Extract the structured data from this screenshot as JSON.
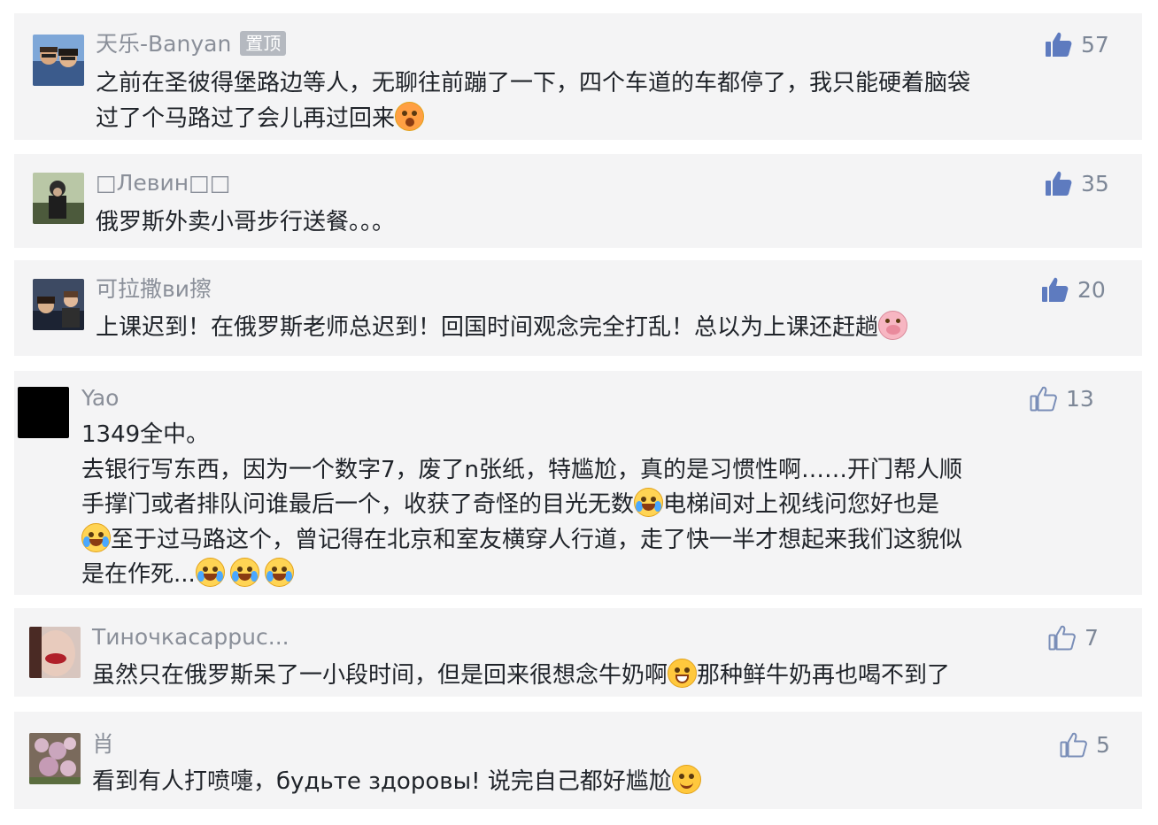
{
  "comments": [
    {
      "user": "天乐-Banyan",
      "badge": "置顶",
      "likes": "57",
      "lines": [
        {
          "text": "之前在圣彼得堡路边等人，无聊往前蹦了一下，四个车道的车都停了，我只能硬着脑袋"
        },
        {
          "text": "过了个马路过了会儿再过回来",
          "emoji_tail": "shocked-face-emoji"
        }
      ]
    },
    {
      "user": "□Левин□□",
      "likes": "35",
      "lines": [
        {
          "text": "俄罗斯外卖小哥步行送餐。。。"
        }
      ]
    },
    {
      "user": "可拉撒ви擦",
      "likes": "20",
      "lines": [
        {
          "text": "上课迟到！在俄罗斯老师总迟到！回国时间观念完全打乱！总以为上课还赶趟",
          "emoji_tail": "pig-face-emoji"
        }
      ]
    },
    {
      "user": "Yao",
      "likes": "13",
      "lines": [
        {
          "text": "1349全中。"
        },
        {
          "text": "去银行写东西，因为一个数字7，废了n张纸，特尴尬，真的是习惯性啊……开门帮人顺"
        },
        {
          "text_a": "手撑门或者排队问谁最后一个，收获了奇怪的目光无数",
          "text_b": "电梯间对上视线问您好也是"
        },
        {
          "text": "至于过马路这个，曾记得在北京和室友横穿人行道，走了快一半才想起来我们这貌似"
        },
        {
          "text": "是在作死..."
        }
      ]
    },
    {
      "user": "Тиночкасappuc...",
      "likes": "7",
      "lines": [
        {
          "text_a": "虽然只在俄罗斯呆了一小段时间，但是回来很想念牛奶啊",
          "text_b": "那种鲜牛奶再也喝不到了"
        }
      ]
    },
    {
      "user": "肖",
      "likes": "5",
      "lines": [
        {
          "text": "看到有人打喷嚏，будьте здоровы! 说完自己都好尴尬",
          "emoji_tail": "smiling-face-emoji"
        }
      ]
    }
  ],
  "colors": {
    "card_bg": "#f4f4f5",
    "username": "#8a8f99",
    "body_text": "#1f2329",
    "like_solid": "#5e7bbf",
    "like_outline": "#7a8eb8",
    "badge_bg": "#b5b9c0"
  }
}
